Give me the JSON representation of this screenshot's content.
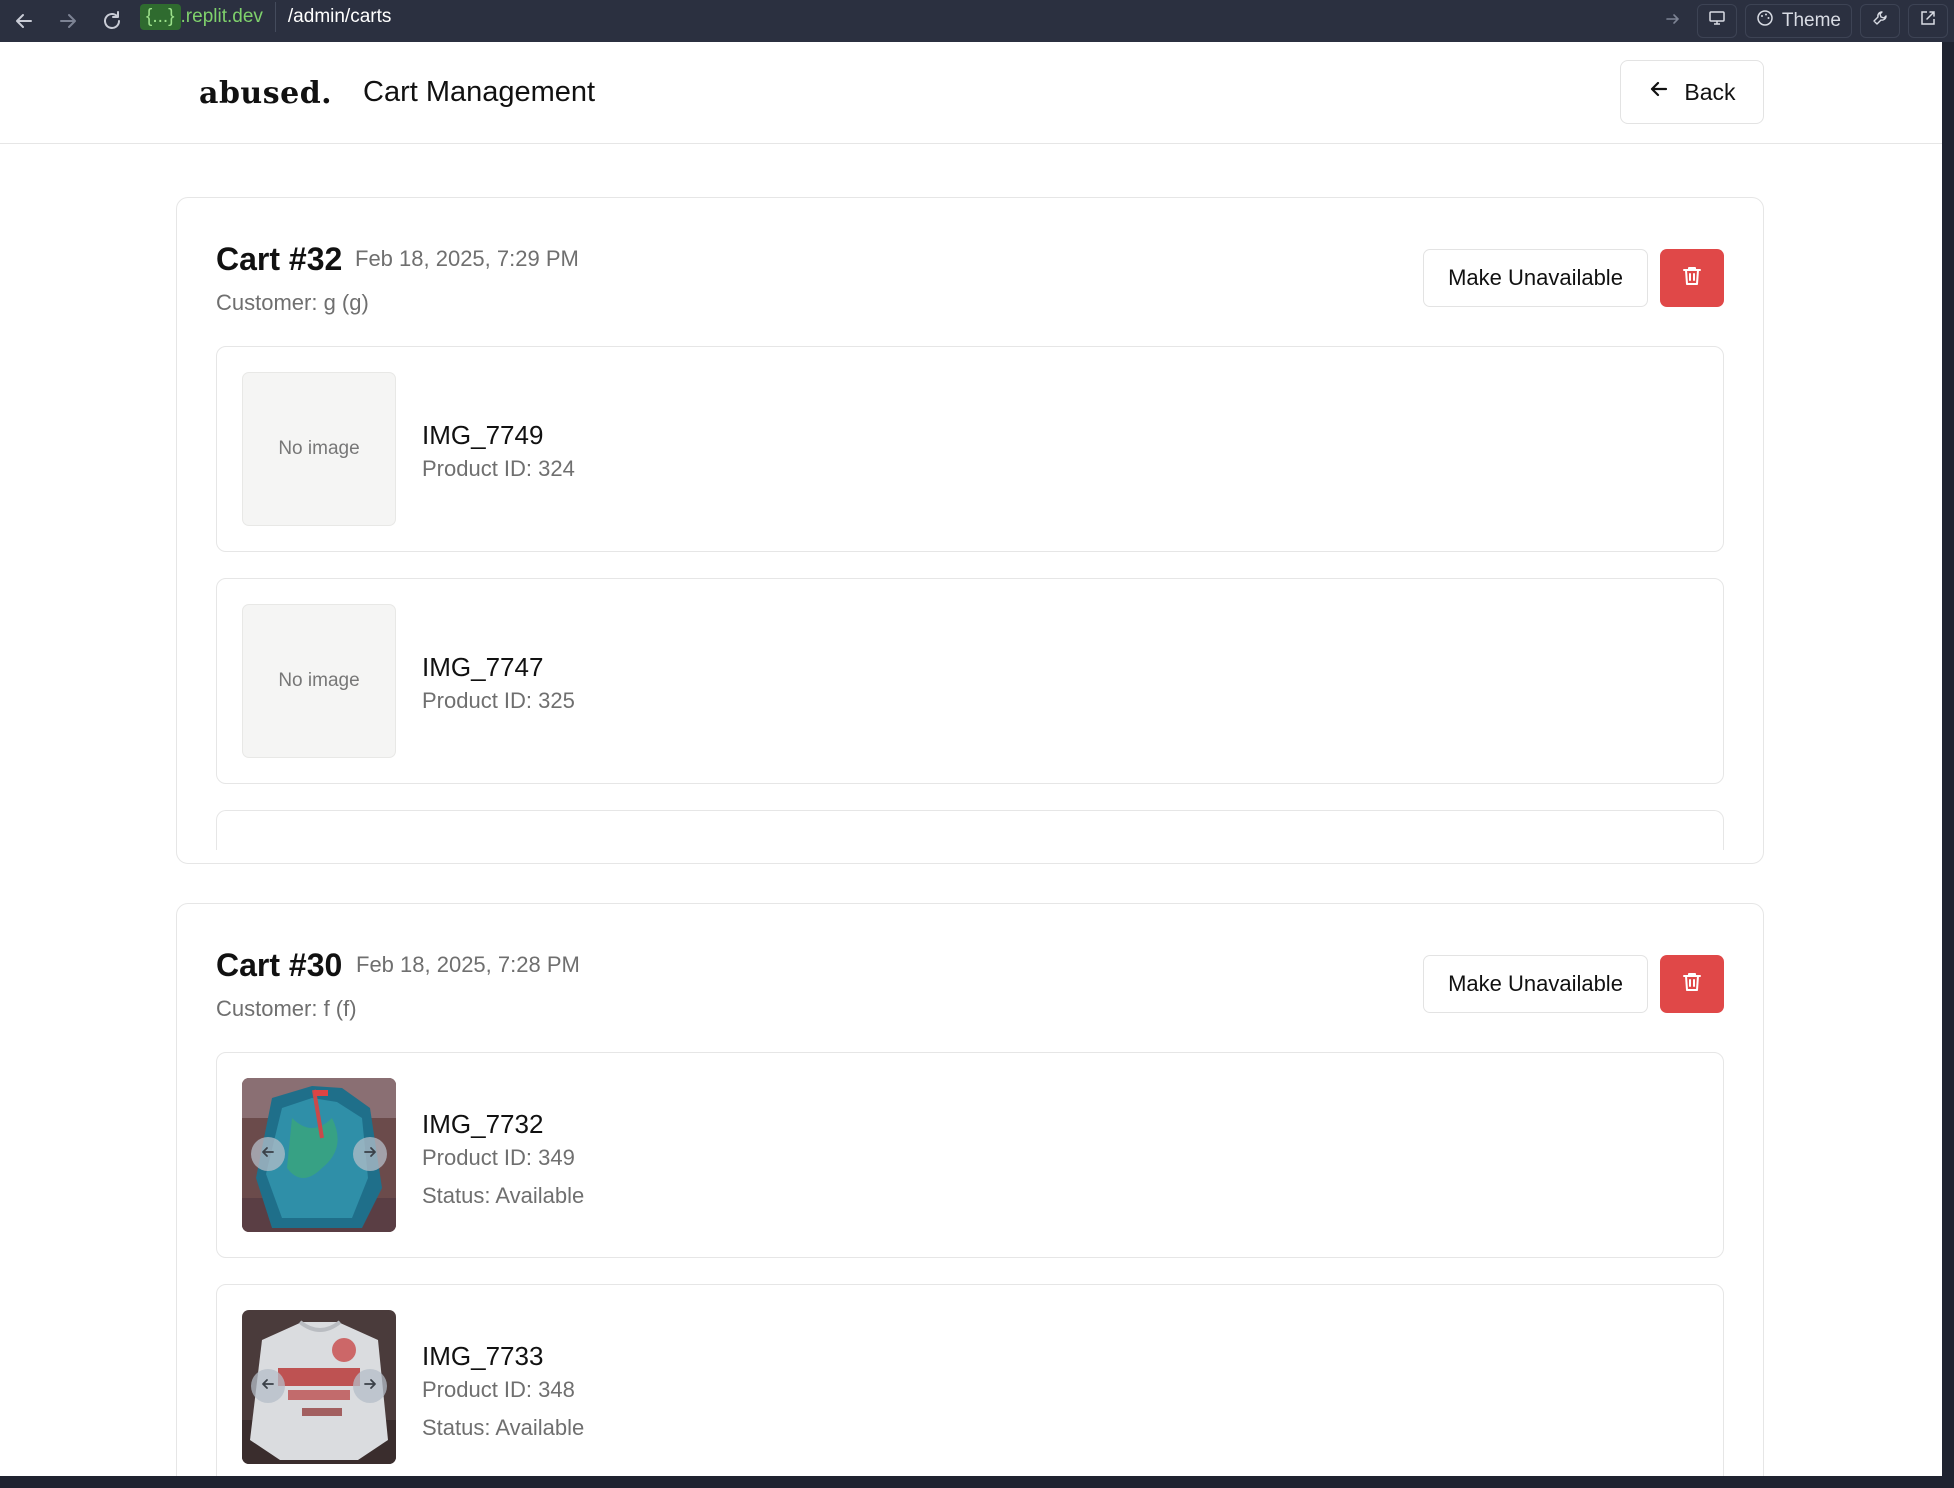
{
  "browser": {
    "host_badge": "{...}",
    "host_rest": ".replit.dev",
    "path": "/admin/carts",
    "theme_label": "Theme"
  },
  "header": {
    "logo": "abused.",
    "title": "Cart Management",
    "back_label": "Back"
  },
  "carts": [
    {
      "title": "Cart #32",
      "date": "Feb 18, 2025, 7:29 PM",
      "customer": "Customer: g (g)",
      "make_unavailable_label": "Make Unavailable",
      "items": [
        {
          "name": "IMG_7749",
          "product_id": "Product ID: 324",
          "image": "No image"
        },
        {
          "name": "IMG_7747",
          "product_id": "Product ID: 325",
          "image": "No image"
        }
      ]
    },
    {
      "title": "Cart #30",
      "date": "Feb 18, 2025, 7:28 PM",
      "customer": "Customer: f (f)",
      "make_unavailable_label": "Make Unavailable",
      "items": [
        {
          "name": "IMG_7732",
          "product_id": "Product ID: 349",
          "status": "Status: Available"
        },
        {
          "name": "IMG_7733",
          "product_id": "Product ID: 348",
          "status": "Status: Available"
        }
      ]
    }
  ],
  "colors": {
    "danger": "#e04848",
    "muted_text": "#6f6f6f",
    "chrome_bg": "#2b3040"
  }
}
